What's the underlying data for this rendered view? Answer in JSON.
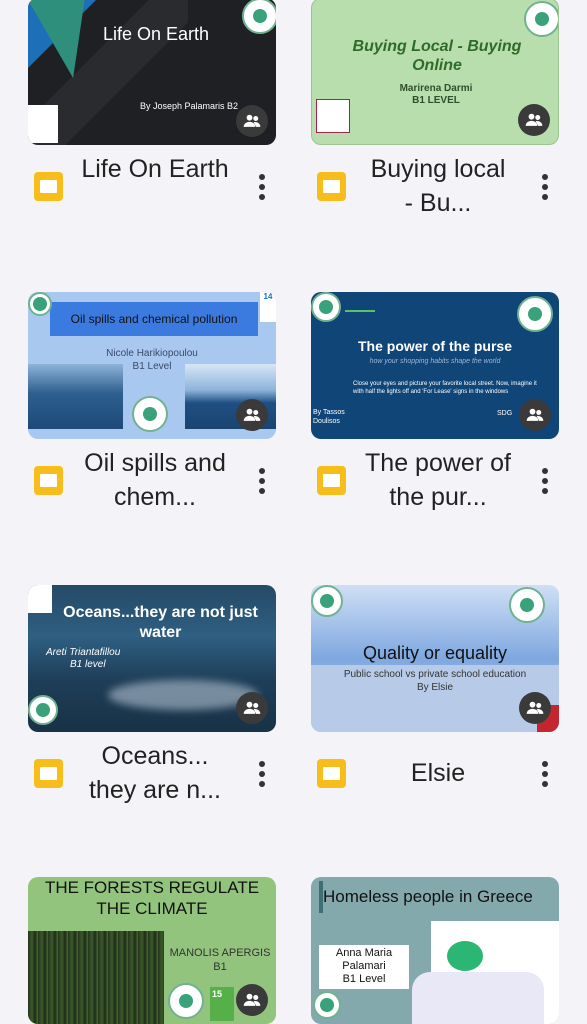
{
  "presentations": [
    {
      "title": "Life On Earth",
      "thumb": {
        "heading": "Life On Earth",
        "byline": "By Joseph Palamaris B2"
      }
    },
    {
      "title": "Buying local - Bu...",
      "thumb": {
        "heading": "Buying Local - Buying Online",
        "author": "Marirena Darmi",
        "level": "B1 LEVEL"
      }
    },
    {
      "title": "Oil spills and chem...",
      "thumb": {
        "heading": "Oil spills and chemical pollution",
        "author": "Nicole Harikiopoulou",
        "level": "B1 Level",
        "sdg": "14"
      }
    },
    {
      "title": "The power of the pur...",
      "thumb": {
        "heading": "The power of the purse",
        "subheading": "how your shopping habits shape the world",
        "body": "Close your eyes and picture your favorite local street. Now, imagine it with half the lights off and 'For Lease' signs in the windows",
        "byline": "By Tassos Doulisos",
        "sdg": "SDG"
      }
    },
    {
      "title": "Oceans... they are n...",
      "thumb": {
        "heading": "Oceans...they are not just water",
        "author": "Areti Triantafillou",
        "level": "B1 level"
      }
    },
    {
      "title": "Elsie",
      "thumb": {
        "heading": "Quality or equality",
        "subheading": "Public school vs private school education",
        "byline": "By Elsie"
      }
    },
    {
      "title": "",
      "thumb": {
        "heading": "THE FORESTS REGULATE THE CLIMATE",
        "author": "MANOLIS APERGIS",
        "level": "B1",
        "sdg": "15"
      }
    },
    {
      "title": "",
      "thumb": {
        "heading": "Homeless people in Greece",
        "author": "Anna Maria Palamari",
        "level": "B1 Level"
      }
    }
  ],
  "colors": {
    "background": "#f4f3f8",
    "slides_icon": "#f7bd1a"
  }
}
